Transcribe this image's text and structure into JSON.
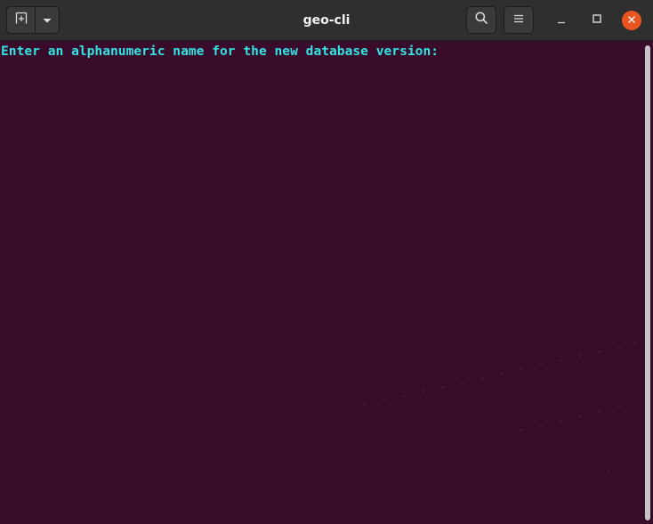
{
  "window": {
    "title": "geo-cli"
  },
  "header": {
    "new_tab_icon": "new-tab-icon",
    "dropdown_icon": "chevron-down-icon",
    "search_icon": "search-icon",
    "menu_icon": "hamburger-menu-icon",
    "minimize_icon": "minimize-icon",
    "maximize_icon": "maximize-icon",
    "close_icon": "close-icon"
  },
  "terminal": {
    "lines": [
      "Enter an alphanumeric name for the new database version: "
    ]
  },
  "colors": {
    "terminal_background": "#380c2a",
    "headerbar_background": "#2f2f2f",
    "prompt_text": "#34e2e2",
    "close_button": "#e95420",
    "scrollbar_thumb": "#c8c3c5"
  }
}
